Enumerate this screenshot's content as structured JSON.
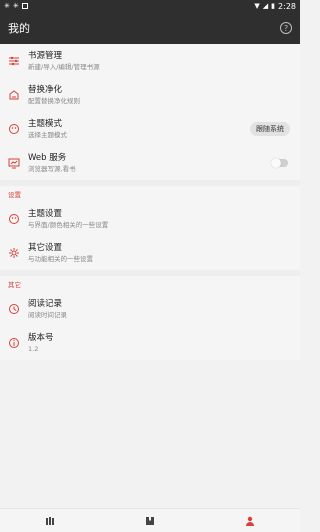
{
  "statusbar": {
    "left_icons": [
      "bug-icon",
      "bug-icon",
      "box-icon"
    ],
    "time": "2:28",
    "right_icons": [
      "wifi-icon",
      "signal-icon",
      "battery-icon"
    ]
  },
  "appbar": {
    "title": "我的",
    "help_icon": "?"
  },
  "main": {
    "items": [
      {
        "title": "书源管理",
        "subtitle": "新建/导入/编辑/管理书源",
        "icon": "sliders-icon"
      },
      {
        "title": "替换净化",
        "subtitle": "配置替换净化规则",
        "icon": "cleanup-icon"
      },
      {
        "title": "主题模式",
        "subtitle": "选择主题模式",
        "icon": "theme-icon",
        "badge": "跟随系统"
      },
      {
        "title": "Web 服务",
        "subtitle": "浏览器写源,看书",
        "icon": "web-icon",
        "toggle": false
      }
    ]
  },
  "settings": {
    "header": "设置",
    "items": [
      {
        "title": "主题设置",
        "subtitle": "与界面/颜色相关的一些设置",
        "icon": "palette-icon"
      },
      {
        "title": "其它设置",
        "subtitle": "与功能相关的一些设置",
        "icon": "gear-icon"
      }
    ]
  },
  "other": {
    "header": "其它",
    "items": [
      {
        "title": "阅读记录",
        "subtitle": "阅读时间记录",
        "icon": "history-icon"
      },
      {
        "title": "版本号",
        "subtitle": "1.2",
        "icon": "info-icon"
      }
    ]
  },
  "bottom_nav": {
    "items": [
      {
        "icon": "bookshelf-icon"
      },
      {
        "icon": "explore-icon"
      },
      {
        "icon": "person-icon",
        "active": true
      }
    ]
  },
  "colors": {
    "accent": "#d8403a",
    "appbar_bg": "#2f2f2f",
    "page_bg": "#f2f2f2"
  }
}
